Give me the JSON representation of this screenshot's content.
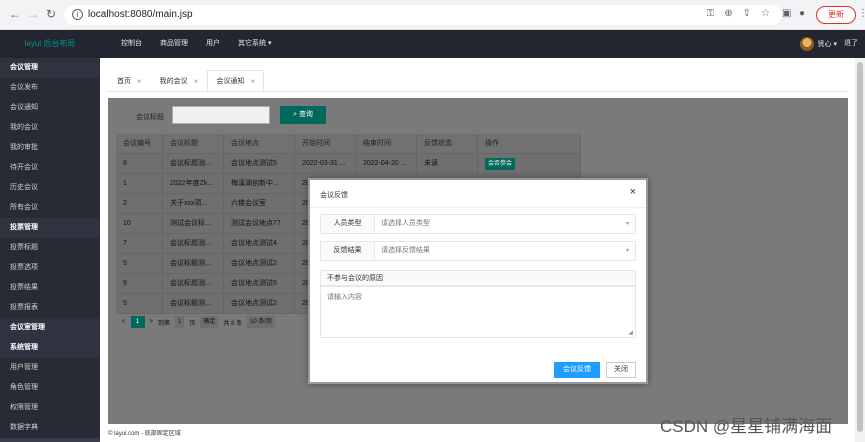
{
  "browser": {
    "url": "localhost:8080/main.jsp",
    "update_label": "更新",
    "icons": [
      "back-icon",
      "forward-icon",
      "reload-icon",
      "info-icon",
      "key-icon",
      "zoom-icon",
      "share-icon",
      "star-icon",
      "sidepanel-icon",
      "profile-icon",
      "menu-icon"
    ]
  },
  "header": {
    "logo": "layui 后台布局",
    "menu": [
      "控制台",
      "商品管理",
      "用户",
      "其它系统 ▾"
    ],
    "user": "贤心 ▾",
    "logout": "退了"
  },
  "sidebar": [
    {
      "type": "group",
      "label": "会议管理"
    },
    {
      "type": "item",
      "label": "会议发布"
    },
    {
      "type": "item",
      "label": "会议通知"
    },
    {
      "type": "item",
      "label": "我的会议"
    },
    {
      "type": "item",
      "label": "我的审批"
    },
    {
      "type": "item",
      "label": "待开会议"
    },
    {
      "type": "item",
      "label": "历史会议"
    },
    {
      "type": "item",
      "label": "所有会议"
    },
    {
      "type": "group",
      "label": "投票管理"
    },
    {
      "type": "item",
      "label": "投票标题"
    },
    {
      "type": "item",
      "label": "投票选项"
    },
    {
      "type": "item",
      "label": "投票结果"
    },
    {
      "type": "item",
      "label": "投票报表"
    },
    {
      "type": "group",
      "label": "会议室管理"
    },
    {
      "type": "group",
      "label": "系统管理"
    },
    {
      "type": "item",
      "label": "用户管理"
    },
    {
      "type": "item",
      "label": "角色管理"
    },
    {
      "type": "item",
      "label": "权限管理"
    },
    {
      "type": "item",
      "label": "数据字典"
    }
  ],
  "tabs": [
    {
      "label": "首页",
      "close": "×"
    },
    {
      "label": "我的会议",
      "close": "×"
    },
    {
      "label": "会议通知",
      "close": "×",
      "active": true
    }
  ],
  "search": {
    "label": "会议标题",
    "value": "",
    "button": "查询"
  },
  "table": {
    "headers": [
      "会议编号",
      "会议标题",
      "会议地点",
      "开始时间",
      "结束时间",
      "反馈状态",
      "操作"
    ],
    "rows": [
      [
        "8",
        "会议标题测...",
        "会议地点测试5",
        "2022-03-31 ...",
        "2022-04-20 ...",
        "未读",
        "会否参会"
      ],
      [
        "1",
        "2022年度Zk...",
        "梅溪湖创新中...",
        "20",
        "",
        "",
        ""
      ],
      [
        "2",
        "关于xxx项...",
        "六楼会议室",
        "20",
        "",
        "",
        ""
      ],
      [
        "10",
        "测试会议标...",
        "测试会议地点77",
        "20",
        "",
        "",
        ""
      ],
      [
        "7",
        "会议标题测...",
        "会议地点测试4",
        "20",
        "",
        "",
        ""
      ],
      [
        "5",
        "会议标题测...",
        "会议地点测试2",
        "20",
        "",
        "",
        ""
      ],
      [
        "9",
        "会议标题测...",
        "会议地点测试6",
        "20",
        "",
        "",
        ""
      ],
      [
        "5",
        "会议标题测...",
        "会议地点测试2",
        "20",
        "",
        "",
        ""
      ]
    ]
  },
  "pager": {
    "prev": "<",
    "current": "1",
    "next": ">",
    "goto_label": "到第",
    "page_input": "1",
    "page_unit": "页",
    "confirm": "确定",
    "total": "共 8 条",
    "size": "10 条/页"
  },
  "footer": {
    "copyright": "© layui.com - 底部固定区域"
  },
  "modal": {
    "title": "会议反馈",
    "close": "×",
    "field1_label": "人员类型",
    "field1_placeholder": "请选择人员类型",
    "field2_label": "反馈结果",
    "field2_placeholder": "请选择反馈结果",
    "textarea_label": "不参与会议的原因",
    "textarea_placeholder": "请输入内容",
    "submit": "会议反馈",
    "cancel": "关闭"
  },
  "watermark": "CSDN @星星铺满海面"
}
